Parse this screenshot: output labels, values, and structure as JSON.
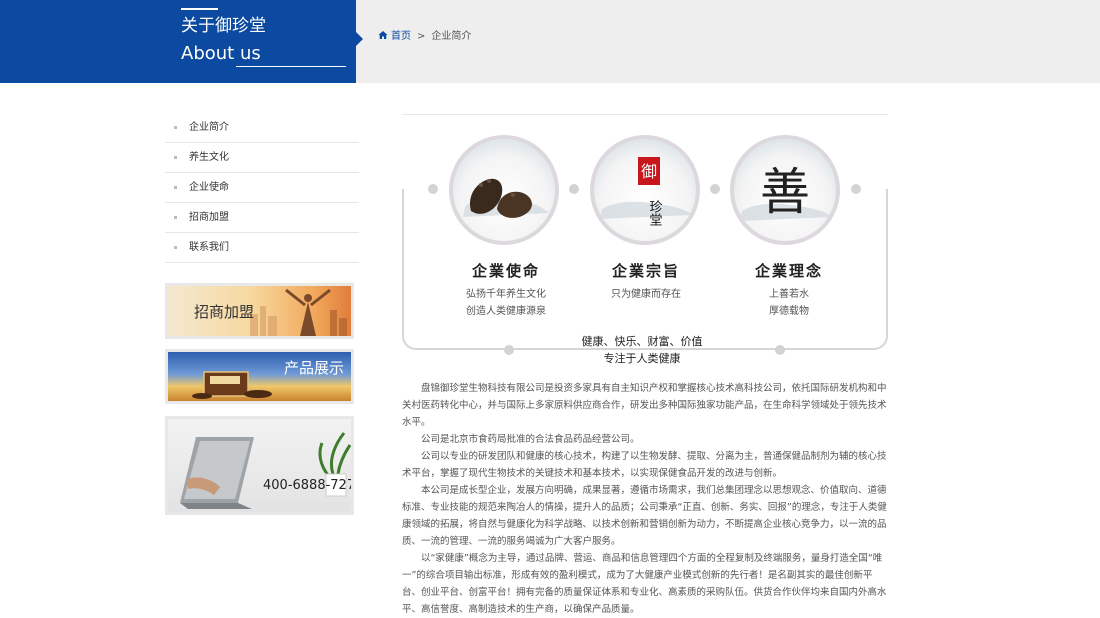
{
  "header": {
    "title_cn": "关于御珍堂",
    "title_en": "About us"
  },
  "breadcrumb": {
    "home": "首页",
    "separator": ">",
    "current": "企业简介"
  },
  "sidebar": {
    "items": [
      {
        "label": "企业简介"
      },
      {
        "label": "养生文化"
      },
      {
        "label": "企业使命"
      },
      {
        "label": "招商加盟"
      },
      {
        "label": "联系我们"
      }
    ]
  },
  "promos": {
    "franchise": "招商加盟",
    "products": "产品展示",
    "phone": "400-6888-727"
  },
  "values": [
    {
      "title": "企業使命",
      "lines": [
        "弘扬千年养生文化",
        "创造人类健康源泉"
      ]
    },
    {
      "title": "企業宗旨",
      "lines": [
        "只为健康而存在"
      ]
    },
    {
      "title": "企業理念",
      "lines": [
        "上善若水",
        "厚德载物"
      ]
    }
  ],
  "circles": {
    "seal_char": "御",
    "brand_chars": "珍堂",
    "philosophy_char": "善"
  },
  "slogan": {
    "line1": "健康、快乐、财富、价值",
    "line2": "专注于人类健康"
  },
  "article": {
    "paragraphs": [
      "盘锦御珍堂生物科技有限公司是投资多家具有自主知识产权和掌握核心技术高科技公司，依托国际研发机构和中关村医药转化中心，并与国际上多家原料供应商合作，研发出多种国际独家功能产品，在生命科学领域处于领先技术水平。",
      "公司是北京市食药局批准的合法食品药品经营公司。",
      "公司以专业的研发团队和健康的核心技术，构建了以生物发酵、提取、分离为主，普通保健品制剂为辅的核心技术平台，掌握了现代生物技术的关键技术和基本技术，以实现保健食品开发的改进与创新。",
      "本公司是成长型企业，发展方向明确，成果显著，遵循市场需求，我们总集团理念以思想观念、价值取向、道德标准、专业技能的规范来陶冶人的情操，提升人的品质；公司秉承“正直、创新、务实、回报”的理念，专注于人类健康领域的拓展，将自然与健康化为科学战略、以技术创新和营销创新为动力，不断提高企业核心竞争力，以一流的品质、一流的管理、一流的服务竭诚为广大客户服务。",
      "以“家健康”概念为主导，通过品牌、营运、商品和信息管理四个方面的全程复制及终端服务，量身打造全国“唯一”的综合项目输出标准，形成有效的盈利模式，成为了大健康产业模式创新的先行者！是名副其实的最佳创新平台、创业平台、创富平台！拥有完备的质量保证体系和专业化、高素质的采购队伍。供货合作伙伴均来自国内外高水平、高信誉度、高制造技术的生产商，以确保产品质量。"
    ]
  },
  "colors": {
    "brand_blue": "#0b4aa0",
    "header_gray": "#eeeeee",
    "seal_red": "#c8161d"
  }
}
